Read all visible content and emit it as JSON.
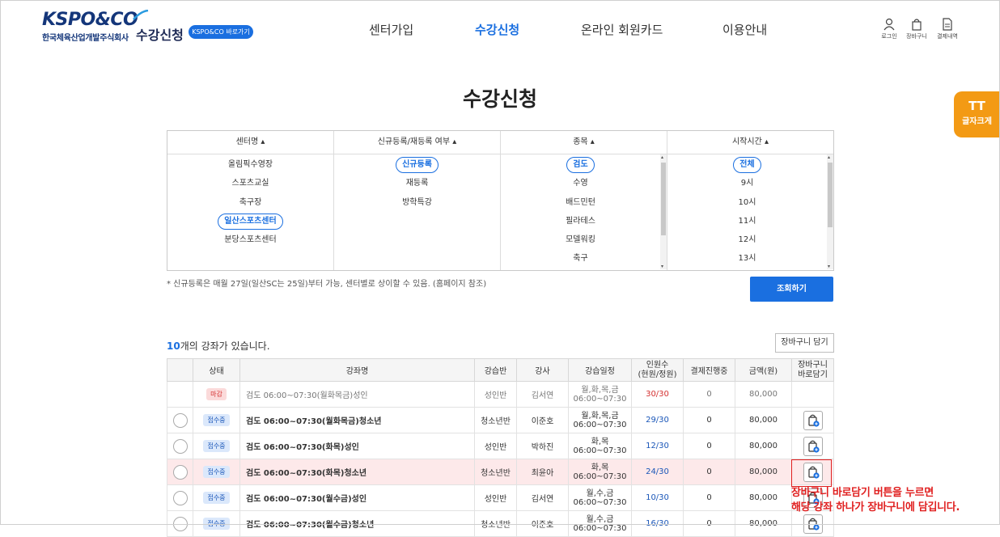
{
  "header": {
    "logo_text": "KSPO&CO",
    "logo_subtitle": "한국체육산업개발주식회사",
    "site_title": "수강신청",
    "kspo_link": "KSPO&CO 바로가기",
    "nav": [
      "센터가입",
      "수강신청",
      "온라인 회원카드",
      "이용안내"
    ],
    "active_nav": "수강신청",
    "utility": [
      "로그인",
      "장바구니",
      "결제내역"
    ]
  },
  "page_title": "수강신청",
  "font_size_button": {
    "icon": "TT",
    "label": "글자크게"
  },
  "filter": {
    "columns": [
      {
        "header": "센터명",
        "items": [
          "올림픽수영장",
          "스포츠교실",
          "축구장",
          "일산스포츠센터",
          "분당스포츠센터"
        ],
        "selected": "일산스포츠센터"
      },
      {
        "header": "신규등록/재등록 여부",
        "items": [
          "신규등록",
          "재등록",
          "방학특강"
        ],
        "selected": "신규등록"
      },
      {
        "header": "종목",
        "items": [
          "검도",
          "수영",
          "배드민턴",
          "필라테스",
          "모델워킹",
          "축구"
        ],
        "selected": "검도"
      },
      {
        "header": "시작시간",
        "items": [
          "전체",
          "9시",
          "10시",
          "11시",
          "12시",
          "13시"
        ],
        "selected": "전체"
      }
    ],
    "note": "* 신규등록은 매월 27일(일산SC는 25일)부터 가능, 센터별로 상이할 수 있음. (홈페이지 참조)",
    "search_label": "조회하기"
  },
  "results": {
    "count_num": "10",
    "count_text": "개의 강좌가 있습니다.",
    "cart_all_label": "장바구니 담기",
    "columns": [
      "상태",
      "강좌명",
      "강습반",
      "강사",
      "강습일정",
      "인원수\n(현원/정원)",
      "결제진행중",
      "금액(원)",
      "장바구니\n바로담기"
    ],
    "rows": [
      {
        "status": "마감",
        "name": "검도 06:00~07:30(월화목금)성인",
        "class": "성인반",
        "teacher": "김서연",
        "sched1": "월,화,목,금",
        "sched2": "06:00~07:30",
        "enrolled": "30/30",
        "pending": "0",
        "price": "80,000",
        "closed": true
      },
      {
        "status": "접수중",
        "name": "검도 06:00~07:30(월화목금)청소년",
        "class": "청소년반",
        "teacher": "이준호",
        "sched1": "월,화,목,금",
        "sched2": "06:00~07:30",
        "enrolled": "29/30",
        "pending": "0",
        "price": "80,000",
        "closed": false
      },
      {
        "status": "접수중",
        "name": "검도 06:00~07:30(화목)성인",
        "class": "성인반",
        "teacher": "박하진",
        "sched1": "화,목",
        "sched2": "06:00~07:30",
        "enrolled": "12/30",
        "pending": "0",
        "price": "80,000",
        "closed": false
      },
      {
        "status": "접수중",
        "name": "검도 06:00~07:30(화목)청소년",
        "class": "청소년반",
        "teacher": "최윤아",
        "sched1": "화,목",
        "sched2": "06:00~07:30",
        "enrolled": "24/30",
        "pending": "0",
        "price": "80,000",
        "closed": false,
        "highlight": true
      },
      {
        "status": "접수중",
        "name": "검도 06:00~07:30(월수금)성인",
        "class": "성인반",
        "teacher": "김서연",
        "sched1": "월,수,금",
        "sched2": "06:00~07:30",
        "enrolled": "10/30",
        "pending": "0",
        "price": "80,000",
        "closed": false
      },
      {
        "status": "접수중",
        "name": "검도 06:00~07:30(월수금)청소년",
        "class": "청소년반",
        "teacher": "이준호",
        "sched1": "월,수,금",
        "sched2": "06:00~07:30",
        "enrolled": "16/30",
        "pending": "0",
        "price": "80,000",
        "closed": false
      }
    ]
  },
  "callout": {
    "line1": "장바구니 바로담기 버튼을 누르면",
    "line2": "해당 강좌 하나가 장바구니에 담깁니다."
  },
  "colors": {
    "accent": "#1a6fe0",
    "brand_navy": "#14367a",
    "orange": "#f39a14",
    "alert_red": "#e02020"
  }
}
